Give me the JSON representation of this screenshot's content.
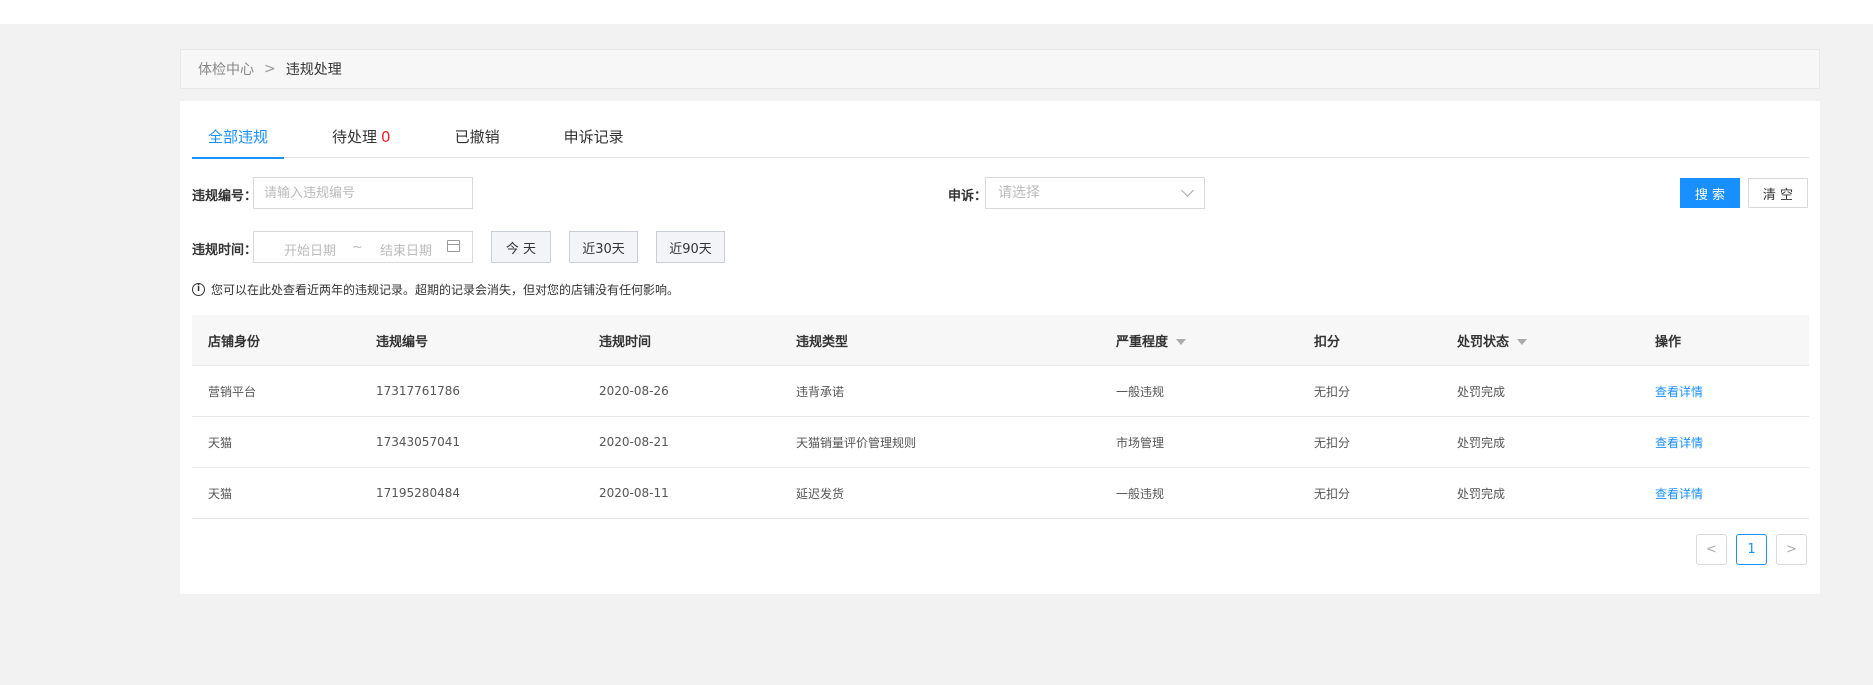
{
  "breadcrumb": {
    "parent": "体检中心",
    "separator": ">",
    "current": "违规处理"
  },
  "tabs": [
    {
      "label": "全部违规",
      "count": ""
    },
    {
      "label": "待处理",
      "count": "0"
    },
    {
      "label": "已撤销",
      "count": ""
    },
    {
      "label": "申诉记录",
      "count": ""
    }
  ],
  "filters": {
    "violation_no_label": "违规编号：",
    "violation_no_placeholder": "请输入违规编号",
    "appeal_label": "申诉：",
    "appeal_placeholder": "请选择",
    "time_label": "违规时间：",
    "start_placeholder": "开始日期",
    "range_sep": "~",
    "end_placeholder": "结束日期",
    "quick": [
      "今 天",
      "近30天",
      "近90天"
    ],
    "search": "搜 索",
    "clear": "清 空"
  },
  "notice": "您可以在此处查看近两年的违规记录。超期的记录会消失，但对您的店铺没有任何影响。",
  "table": {
    "headers": [
      "店铺身份",
      "违规编号",
      "违规时间",
      "违规类型",
      "严重程度",
      "扣分",
      "处罚状态",
      "操作"
    ],
    "rows": [
      [
        "营销平台",
        "17317761786",
        "2020-08-26",
        "违背承诺",
        "一般违规",
        "无扣分",
        "处罚完成",
        "查看详情"
      ],
      [
        "天猫",
        "17343057041",
        "2020-08-21",
        "天猫销量评价管理规则",
        "市场管理",
        "无扣分",
        "处罚完成",
        "查看详情"
      ],
      [
        "天猫",
        "17195280484",
        "2020-08-11",
        "延迟发货",
        "一般违规",
        "无扣分",
        "处罚完成",
        "查看详情"
      ]
    ]
  },
  "pagination": {
    "prev": "<",
    "current": "1",
    "next": ">"
  }
}
